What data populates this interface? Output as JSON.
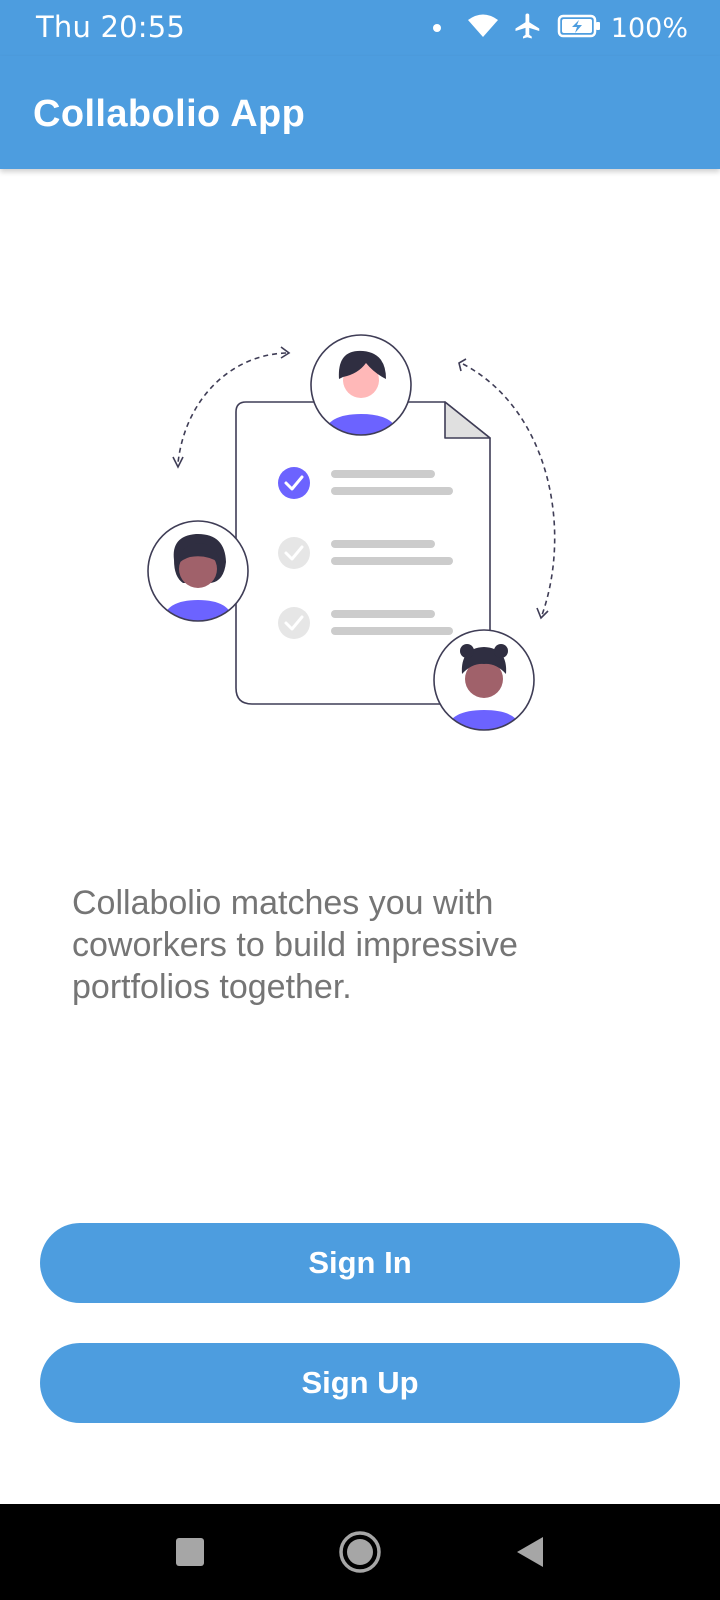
{
  "status_bar": {
    "time": "Thu 20:55",
    "battery_percent": "100%",
    "icons": [
      "notification-dot-icon",
      "wifi-icon",
      "airplane-mode-icon",
      "battery-charging-icon"
    ]
  },
  "app_bar": {
    "title": "Collabolio App"
  },
  "main": {
    "illustration_icon": "collaboration-checklist-illustration",
    "tagline": "Collabolio matches you with coworkers to build impressive portfolios together."
  },
  "actions": {
    "sign_in_label": "Sign In",
    "sign_up_label": "Sign Up"
  },
  "nav_bar": {
    "icons": [
      "recent-apps-icon",
      "home-icon",
      "back-icon"
    ]
  },
  "colors": {
    "primary": "#4d9ddf",
    "illustration_accent": "#6c63ff",
    "text_secondary": "#757575"
  }
}
